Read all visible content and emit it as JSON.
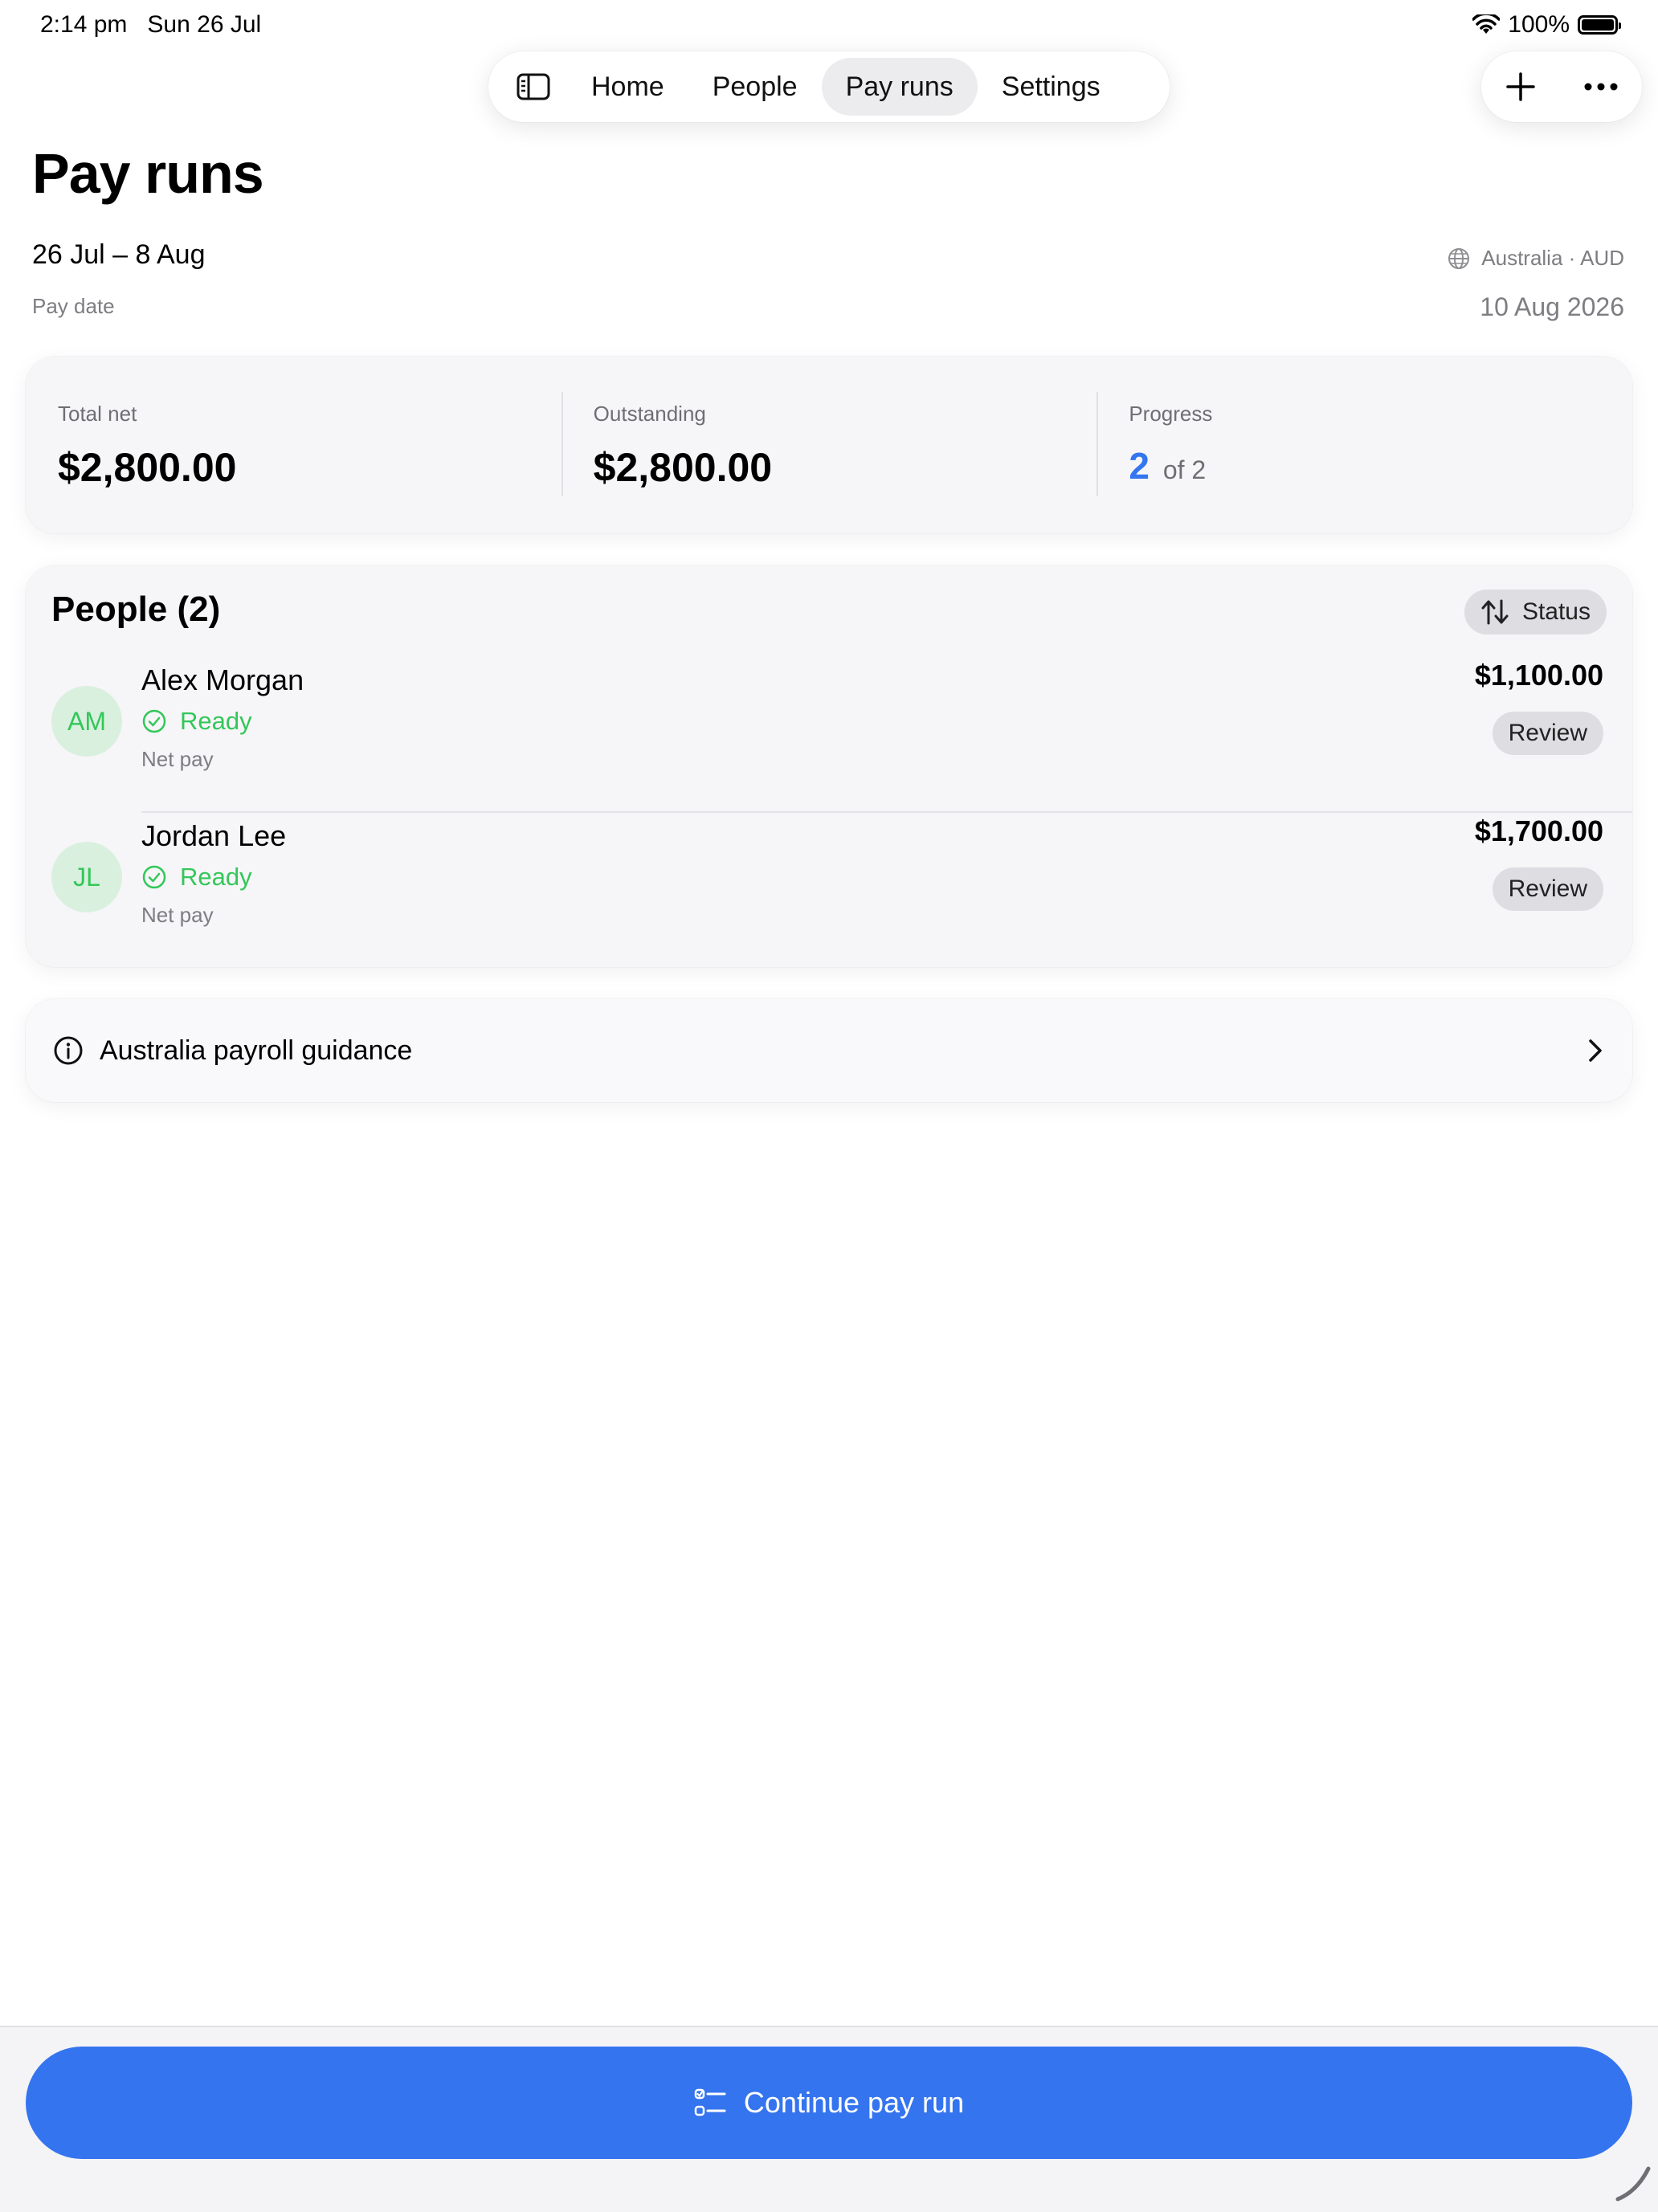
{
  "status_bar": {
    "time": "2:14 pm",
    "date": "Sun 26 Jul",
    "battery": "100%"
  },
  "nav": {
    "sidebar_icon": "sidebar-icon",
    "tabs": [
      {
        "label": "Home",
        "active": false
      },
      {
        "label": "People",
        "active": false
      },
      {
        "label": "Pay runs",
        "active": true
      },
      {
        "label": "Settings",
        "active": false
      }
    ]
  },
  "actions": {
    "add_icon": "plus-icon",
    "more_icon": "ellipsis-icon"
  },
  "page": {
    "title": "Pay runs",
    "period": "26 Jul – 8 Aug",
    "pay_date_label": "Pay date",
    "pay_date": "10 Aug 2026",
    "region": "Australia · AUD"
  },
  "summary": {
    "total_net_label": "Total net",
    "total_net": "$2,800.00",
    "outstanding_label": "Outstanding",
    "outstanding": "$2,800.00",
    "progress_label": "Progress",
    "progress_done": "2",
    "progress_of": "of 2"
  },
  "people": {
    "title": "People (2)",
    "sort_label": "Status",
    "rows": [
      {
        "initials": "AM",
        "name": "Alex Morgan",
        "status": "Ready",
        "sub": "Net pay",
        "amount": "$1,100.00",
        "action": "Review"
      },
      {
        "initials": "JL",
        "name": "Jordan Lee",
        "status": "Ready",
        "sub": "Net pay",
        "amount": "$1,700.00",
        "action": "Review"
      }
    ]
  },
  "guidance": {
    "label": "Australia payroll guidance"
  },
  "footer": {
    "continue_label": "Continue pay run"
  },
  "colors": {
    "accent": "#3574ef",
    "ready": "#34c759",
    "avatar_bg": "#d9f0df"
  }
}
